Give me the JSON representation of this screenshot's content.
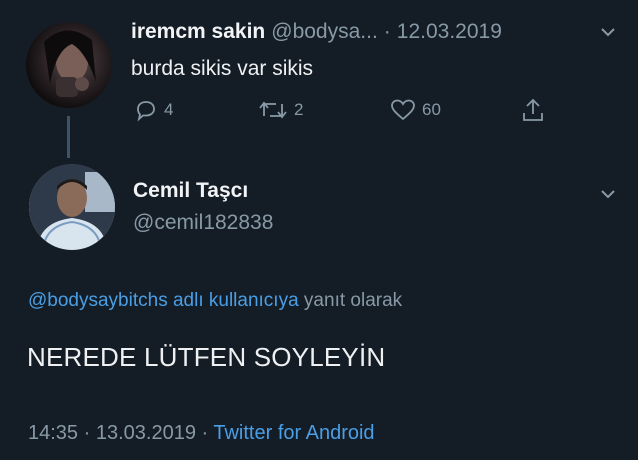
{
  "parent_tweet": {
    "display_name": "iremcm sakin",
    "handle": "@bodysa...",
    "separator": "·",
    "date": "12.03.2019",
    "text": "burda sikis var sikis",
    "replies": "4",
    "retweets": "2",
    "likes": "60",
    "icons": [
      "reply-icon",
      "retweet-icon",
      "like-icon",
      "share-icon",
      "chevron-down-icon"
    ]
  },
  "reply_tweet": {
    "display_name": "Cemil Taşcı",
    "handle": "@cemil182838",
    "replying_to_link": "@bodysaybitchs adlı kullanıcıya",
    "replying_to_suffix": " yanıt olarak",
    "text": "NEREDE LÜTFEN SOYLEYİN",
    "time": "14:35",
    "separator": " · ",
    "date": "13.03.2019",
    "separator2": " · ",
    "source": "Twitter for Android"
  },
  "colors": {
    "background": "#141d26",
    "muted": "#8899a6",
    "link": "#4a9ee6",
    "thread_line": "#3d5466"
  }
}
